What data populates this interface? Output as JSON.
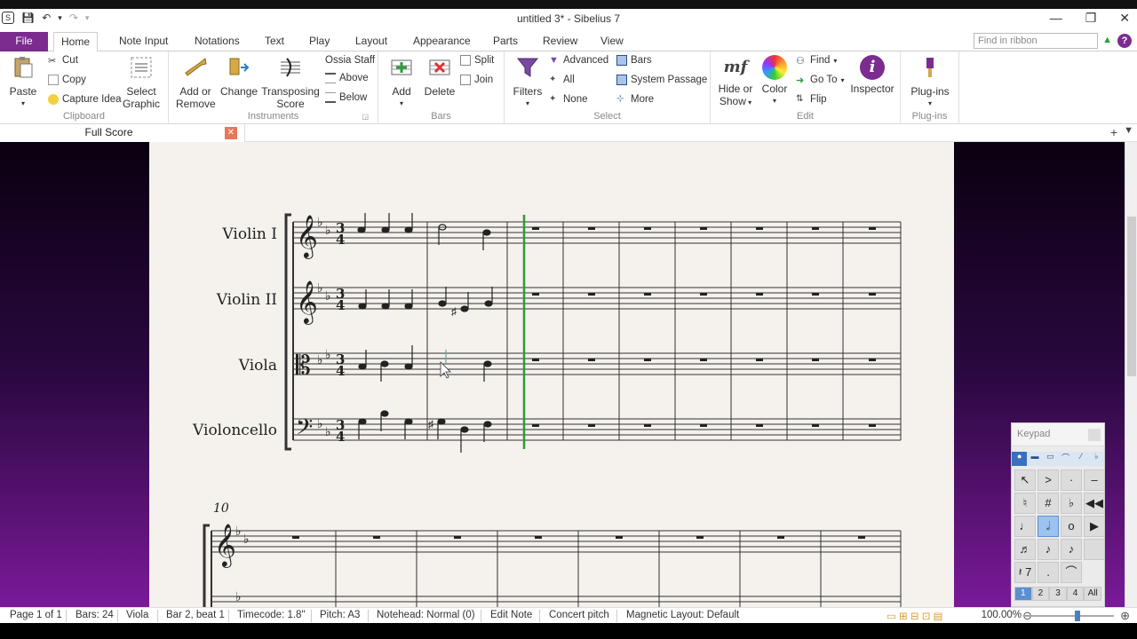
{
  "window": {
    "title": "untitled 3* - Sibelius 7"
  },
  "tabs": [
    "File",
    "Home",
    "Note Input",
    "Notations",
    "Text",
    "Play",
    "Layout",
    "Appearance",
    "Parts",
    "Review",
    "View"
  ],
  "find_placeholder": "Find in ribbon",
  "ribbon": {
    "clipboard": {
      "label": "Clipboard",
      "paste": "Paste",
      "cut": "Cut",
      "copy": "Copy",
      "capture": "Capture Idea",
      "select_graphic_1": "Select",
      "select_graphic_2": "Graphic"
    },
    "instruments": {
      "label": "Instruments",
      "add_1": "Add or",
      "add_2": "Remove",
      "change": "Change",
      "transposing_1": "Transposing",
      "transposing_2": "Score",
      "ossia": "Ossia Staff",
      "above": "Above",
      "below": "Below"
    },
    "bars": {
      "label": "Bars",
      "add": "Add",
      "delete": "Delete",
      "split": "Split",
      "join": "Join"
    },
    "select": {
      "label": "Select",
      "filters": "Filters",
      "advanced": "Advanced",
      "all": "All",
      "none": "None",
      "bars": "Bars",
      "system_passage": "System Passage",
      "more": "More"
    },
    "edit": {
      "label": "Edit",
      "hide_1": "Hide or",
      "hide_2": "Show",
      "color": "Color",
      "find": "Find",
      "goto": "Go To",
      "flip": "Flip",
      "inspector": "Inspector"
    },
    "plugins": {
      "label": "Plug-ins",
      "plugins": "Plug-ins"
    }
  },
  "document_tab": "Full Score",
  "score": {
    "instruments": [
      "Violin I",
      "Violin II",
      "Viola",
      "Violoncello"
    ],
    "system2_bar_number": "10"
  },
  "keypad": {
    "title": "Keypad",
    "layouts": [
      "1",
      "2",
      "3",
      "4",
      "All"
    ],
    "keys": [
      ">",
      "·",
      "–",
      "♮",
      "#",
      "♭",
      "♪",
      "o",
      "♬"
    ]
  },
  "status": {
    "page": "Page 1 of 1",
    "bars": "Bars: 24",
    "instrument": "Viola",
    "position": "Bar 2, beat 1",
    "timecode": "Timecode: 1.8\"",
    "pitch": "Pitch: A3",
    "notehead": "Notehead: Normal (0)",
    "mode": "Edit Note",
    "concert": "Concert pitch",
    "magnetic": "Magnetic Layout: Default",
    "zoom": "100.00%"
  },
  "colors": {
    "accent": "#7b2c8f",
    "playline": "#2d9a3c"
  }
}
